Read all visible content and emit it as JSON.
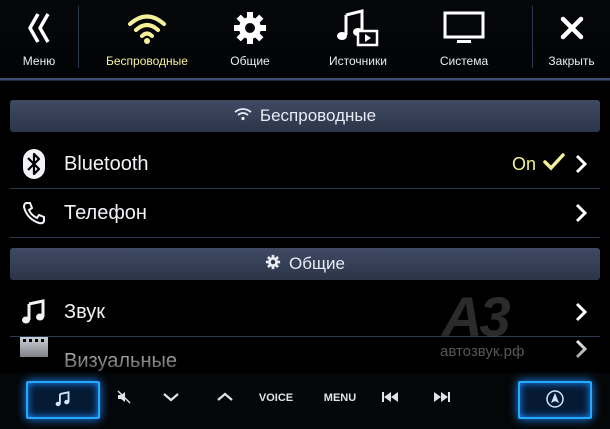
{
  "nav": {
    "menu": {
      "label": "Меню",
      "icon": "double-chevron-left-icon"
    },
    "wireless": {
      "label": "Беспроводные",
      "icon": "wifi-icon",
      "active": true
    },
    "general": {
      "label": "Общие",
      "icon": "gear-icon"
    },
    "sources": {
      "label": "Источники",
      "icon": "music-source-icon"
    },
    "system": {
      "label": "Система",
      "icon": "monitor-icon"
    },
    "close": {
      "label": "Закрыть",
      "icon": "close-icon"
    }
  },
  "sections": {
    "wireless_header": "Беспроводные",
    "general_header": "Общие"
  },
  "rows": {
    "bluetooth": {
      "label": "Bluetooth",
      "state": "On",
      "icon": "bluetooth-icon"
    },
    "phone": {
      "label": "Телефон",
      "icon": "phone-icon"
    },
    "sound": {
      "label": "Звук",
      "icon": "music-note-icon"
    },
    "visual": {
      "label": "Визуальные",
      "icon": "film-icon"
    }
  },
  "watermark": {
    "logo": "A3",
    "text": "автозвук.рф"
  },
  "hardware": {
    "voice": "VOICE",
    "menu": "MENU"
  },
  "colors": {
    "accent_yellow": "#f4f19a",
    "glow_blue": "#27a8ff",
    "section_bg": "#3a455c"
  }
}
